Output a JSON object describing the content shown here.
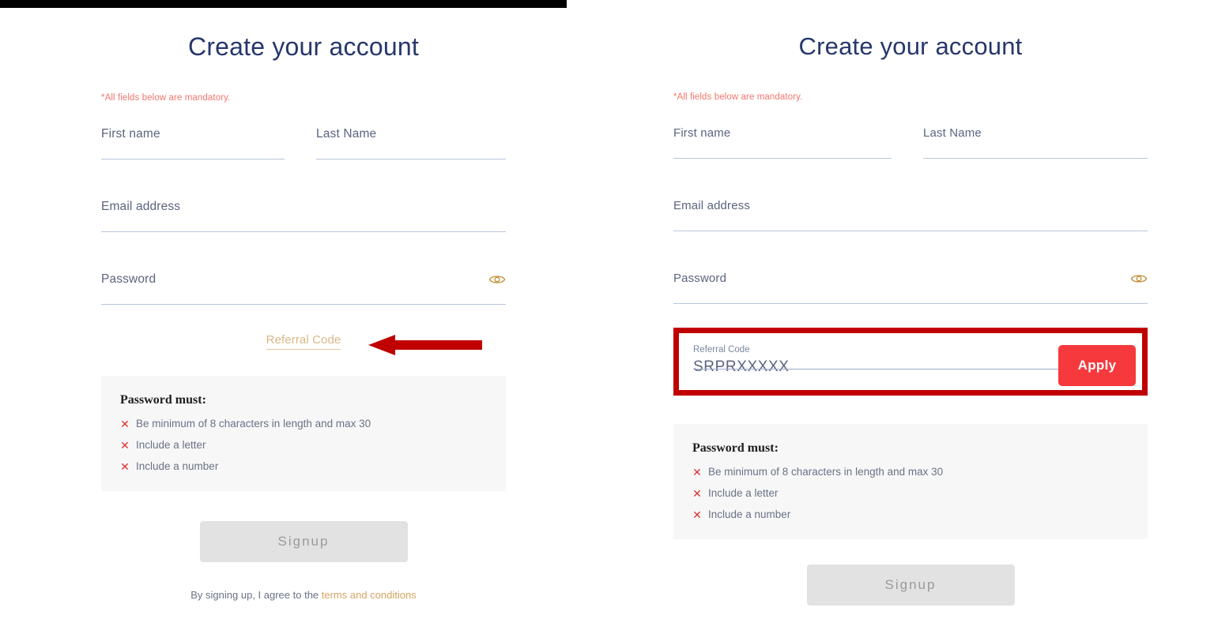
{
  "page": {
    "title": "Create your account",
    "mandatory_note": "*All fields below are mandatory."
  },
  "colors": {
    "title": "#27376b",
    "mandatory_note": "#f4766d",
    "field_label": "#5b6480",
    "field_underline": "#b9c4dd",
    "referral_link": "#d9b787",
    "apply_button": "#f5393d",
    "highlight_box_border": "#c00000",
    "annotation_arrow": "#c00000",
    "eye_icon": "#c5913f",
    "signup_button_bg": "#e2e2e2",
    "signup_button_text": "#9a9a9a",
    "rules_box_bg": "#f7f7f8",
    "rule_x": "#e03131",
    "terms_link": "#d6a461"
  },
  "left_panel": {
    "title": "Create your account",
    "mandatory_note": "*All fields below are mandatory.",
    "fields": {
      "first_name_label": "First name",
      "last_name_label": "Last Name",
      "email_label": "Email address",
      "password_label": "Password",
      "first_name_value": "",
      "last_name_value": "",
      "email_value": "",
      "password_value": ""
    },
    "password_toggle_icon": "eye-icon",
    "referral_link_label": "Referral Code",
    "annotation_arrow_icon": "left-arrow-icon",
    "rules": {
      "heading": "Password must:",
      "items": [
        {
          "status_icon": "x-mark-icon",
          "text": "Be minimum of 8 characters in length and max 30"
        },
        {
          "status_icon": "x-mark-icon",
          "text": "Include a letter"
        },
        {
          "status_icon": "x-mark-icon",
          "text": "Include a number"
        }
      ]
    },
    "signup_label": "Signup",
    "terms_prefix": "By signing up, I agree to the ",
    "terms_link_label": "terms and conditions"
  },
  "right_panel": {
    "title": "Create your account",
    "mandatory_note": "*All fields below are mandatory.",
    "fields": {
      "first_name_label": "First name",
      "last_name_label": "Last Name",
      "email_label": "Email address",
      "password_label": "Password",
      "first_name_value": "",
      "last_name_value": "",
      "email_value": "",
      "password_value": ""
    },
    "password_toggle_icon": "eye-icon",
    "referral": {
      "label": "Referral Code",
      "value": "SRPRXXXXX",
      "apply_label": "Apply",
      "highlighted": true
    },
    "rules": {
      "heading": "Password must:",
      "items": [
        {
          "status_icon": "x-mark-icon",
          "text": "Be minimum of 8 characters in length and max 30"
        },
        {
          "status_icon": "x-mark-icon",
          "text": "Include a letter"
        },
        {
          "status_icon": "x-mark-icon",
          "text": "Include a number"
        }
      ]
    },
    "signup_label": "Signup"
  },
  "glyphs": {
    "x_mark": "✕"
  }
}
